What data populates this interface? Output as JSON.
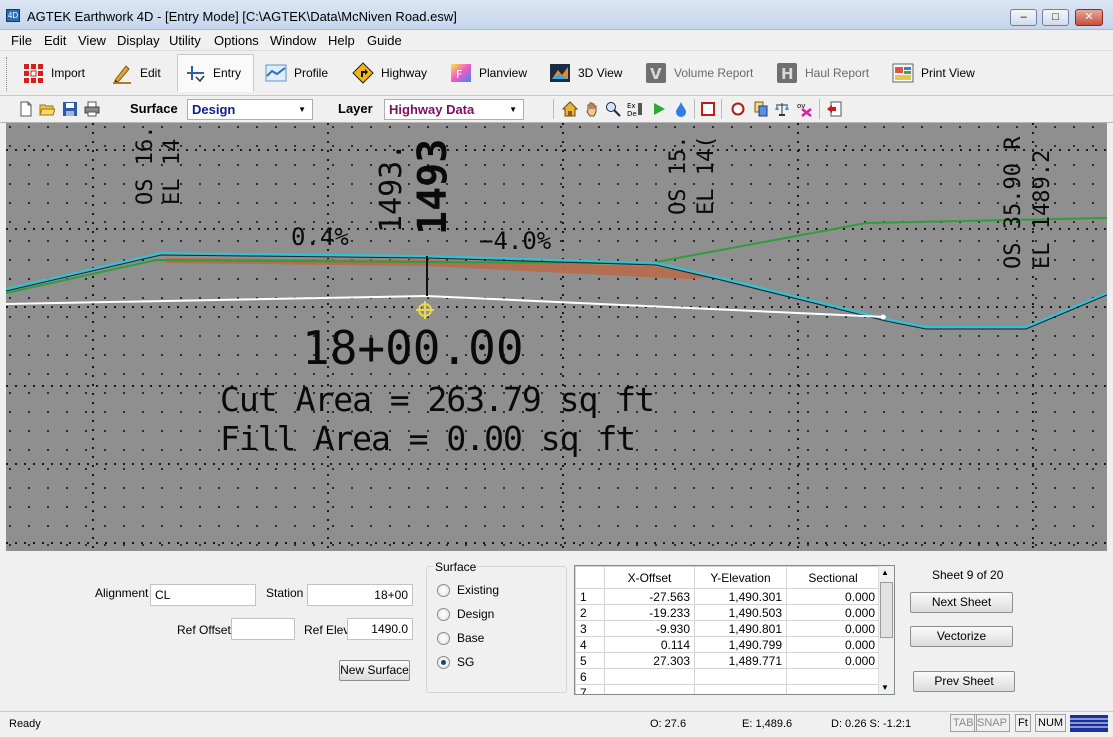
{
  "window": {
    "title": "AGTEK Earthwork 4D - [Entry Mode]  [C:\\AGTEK\\Data\\McNiven Road.esw]",
    "app_icon_text": "4D"
  },
  "menu": [
    "File",
    "Edit",
    "View",
    "Display",
    "Utility",
    "Options",
    "Window",
    "Help",
    "Guide"
  ],
  "toolbar": [
    {
      "label": "Import",
      "icon": "import-icon"
    },
    {
      "label": "Edit",
      "icon": "pencil-icon"
    },
    {
      "label": "Entry",
      "icon": "entry-icon",
      "active": true
    },
    {
      "label": "Profile",
      "icon": "profile-icon"
    },
    {
      "label": "Highway",
      "icon": "highway-icon"
    },
    {
      "label": "Planview",
      "icon": "planview-icon"
    },
    {
      "label": "3D View",
      "icon": "3d-view-icon"
    },
    {
      "label": "Volume Report",
      "icon": "volume-report-icon",
      "disabled": true
    },
    {
      "label": "Haul Report",
      "icon": "haul-report-icon",
      "disabled": true
    },
    {
      "label": "Print View",
      "icon": "print-view-icon"
    }
  ],
  "toolbar2": {
    "surface_label": "Surface",
    "surface_value": "Design",
    "layer_label": "Layer",
    "layer_value": "Highway Data"
  },
  "canvas_text": {
    "slope_left": "0.4%",
    "slope_right": "−4.0%",
    "station": "18+00.00",
    "cut_line": "Cut  Area  =  263.79  sq  ft",
    "fill_line": "Fill  Area  =  0.00  sq  ft",
    "elev_a": "1493.",
    "elev_b": "1493",
    "os_left": "OS 16.",
    "el_left": "EL 14",
    "os_mid": "OS 15.",
    "el_mid": "EL 14(",
    "os_right": "OS 35.90 R",
    "el_right": "EL 1489.2"
  },
  "form": {
    "alignment_label": "Alignment",
    "alignment_value": "CL",
    "station_label": "Station",
    "station_value": "18+00",
    "ref_offset_label": "Ref Offset",
    "ref_offset_value": "",
    "ref_elev_label": "Ref Elev",
    "ref_elev_value": "1490.0",
    "new_surface_button": "New Surface"
  },
  "surface_group": {
    "title": "Surface",
    "options": [
      "Existing",
      "Design",
      "Base",
      "SG"
    ],
    "selected": "SG"
  },
  "table": {
    "headers": [
      "",
      "X-Offset",
      "Y-Elevation",
      "Sectional"
    ],
    "rows": [
      [
        "1",
        "-27.563",
        "1,490.301",
        "0.000"
      ],
      [
        "2",
        "-19.233",
        "1,490.503",
        "0.000"
      ],
      [
        "3",
        "-9.930",
        "1,490.801",
        "0.000"
      ],
      [
        "4",
        "0.114",
        "1,490.799",
        "0.000"
      ],
      [
        "5",
        "27.303",
        "1,489.771",
        "0.000"
      ],
      [
        "6",
        "",
        "",
        ""
      ],
      [
        "7",
        "",
        "",
        ""
      ]
    ]
  },
  "sheet": {
    "label": "Sheet 9 of 20",
    "next_button": "Next Sheet",
    "vectorize_button": "Vectorize",
    "prev_button": "Prev Sheet"
  },
  "status": {
    "ready": "Ready",
    "offset": "O: 27.6",
    "elevation": "E: 1,489.6",
    "distance_slope": "D: 0.26 S: -1.2:1",
    "tab": "TAB",
    "snap": "SNAP",
    "ft": "Ft",
    "num": "NUM"
  },
  "colors": {
    "design_line": "#2ec4d8",
    "existing_line": "#2f9e3a",
    "subgrade_line": "#ffffff",
    "fill_band": "#b86a4a",
    "canvas_bg": "#8f8f8f"
  }
}
